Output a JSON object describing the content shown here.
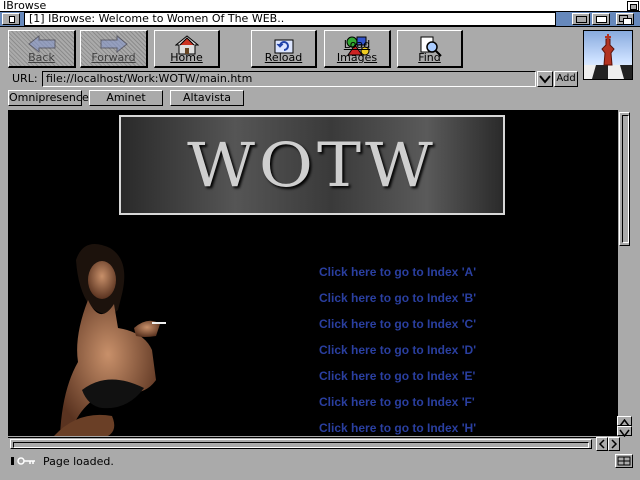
{
  "screen": {
    "title": "IBrowse"
  },
  "window": {
    "title": "[1] IBrowse: Welcome to Women Of The WEB.."
  },
  "toolbar": {
    "back": {
      "label": "Back",
      "icon": "back-arrow-icon",
      "disabled": true
    },
    "forward": {
      "label": "Forward",
      "icon": "forward-arrow-icon",
      "disabled": true
    },
    "home": {
      "label": "Home",
      "icon": "house-icon"
    },
    "reload": {
      "label": "Reload",
      "icon": "reload-icon"
    },
    "load_images": {
      "label": "Load Images",
      "icon": "images-icon"
    },
    "find": {
      "label": "Find",
      "icon": "find-icon"
    }
  },
  "url_bar": {
    "label": "URL:",
    "value": "file://localhost/Work:WOTW/main.htm",
    "add_label": "Add"
  },
  "bookmarks": [
    "Omnipresence",
    "Aminet",
    "Altavista"
  ],
  "page": {
    "banner_text": "WOTW",
    "index_links": [
      "Click here to go to Index 'A'",
      "Click here to go to Index 'B'",
      "Click here to go to Index 'C'",
      "Click here to go to Index 'D'",
      "Click here to go to Index 'E'",
      "Click here to go to Index 'F'",
      "Click here to go to Index 'H'"
    ]
  },
  "status": {
    "text": "Page loaded."
  },
  "colors": {
    "window_bar": "#6688bb",
    "chrome": "#aaaaaa",
    "link": "#2a3fa0",
    "page_bg": "#000000"
  }
}
